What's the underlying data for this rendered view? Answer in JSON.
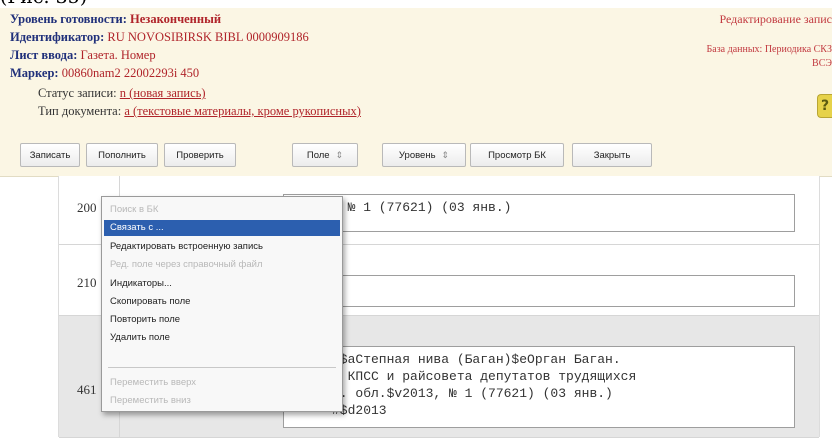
{
  "caption": "(Рис. 35)",
  "header": {
    "readiness_label": "Уровень готовности:",
    "readiness_value": "Незаконченный",
    "identifier_label": "Идентификатор:",
    "identifier_value": "RU NOVOSIBIRSK BIBL 0000909186",
    "input_sheet_label": "Лист ввода:",
    "input_sheet_value": "Газета. Номер",
    "marker_label": "Маркер:",
    "marker_value": "00860nam2 22002293i 450",
    "record_status_label": "Статус записи:",
    "record_status_value": "n (новая запись)",
    "doc_type_label": "Тип документа:",
    "doc_type_value": "a (текстовые материалы, кроме рукописных)",
    "right_title": "Редактирование запис",
    "right_db_line": "База данных: Периодика СКЗ",
    "right_db_line2": "ВСЭ",
    "help_icon": "?"
  },
  "toolbar": {
    "save": "Записать",
    "save_as": "Пополнить",
    "check": "Проверить",
    "field": "Поле",
    "level": "Уровень",
    "view_bk": "Просмотр БК",
    "close": "Закрыть",
    "dropdown_caret": "⇕"
  },
  "fields": [
    {
      "tag": "200",
      "text": ", № 1 (77621) (03 янв.)"
    },
    {
      "tag": "210",
      "text": ""
    },
    {
      "tag": "461",
      "text": "#$aСтепная нива (Баган)$eОрган Баган.\nа КПСС и райсовета депутатов трудящихся\nб. обл.$v2013, № 1 (77621) (03 янв.)\n#$d2013"
    }
  ],
  "context_menu": {
    "items": [
      {
        "label": "Поиск в БК",
        "state": "disabled"
      },
      {
        "label": "Связать с ...",
        "state": "selected"
      },
      {
        "label": "Редактировать встроенную запись",
        "state": "normal"
      },
      {
        "label": "Ред. поле через справочный файл",
        "state": "disabled"
      },
      {
        "label": "Индикаторы...",
        "state": "normal"
      },
      {
        "label": "Скопировать поле",
        "state": "normal"
      },
      {
        "label": "Повторить поле",
        "state": "normal"
      },
      {
        "label": "Удалить поле",
        "state": "normal"
      },
      {
        "label": "Переместить вверх",
        "state": "disabled"
      },
      {
        "label": "Переместить вниз",
        "state": "disabled"
      }
    ]
  },
  "colors": {
    "header_bg": "#fbf6e4",
    "label_blue": "#20307a",
    "value_red": "#b0242a",
    "menu_highlight": "#2c5faf"
  }
}
